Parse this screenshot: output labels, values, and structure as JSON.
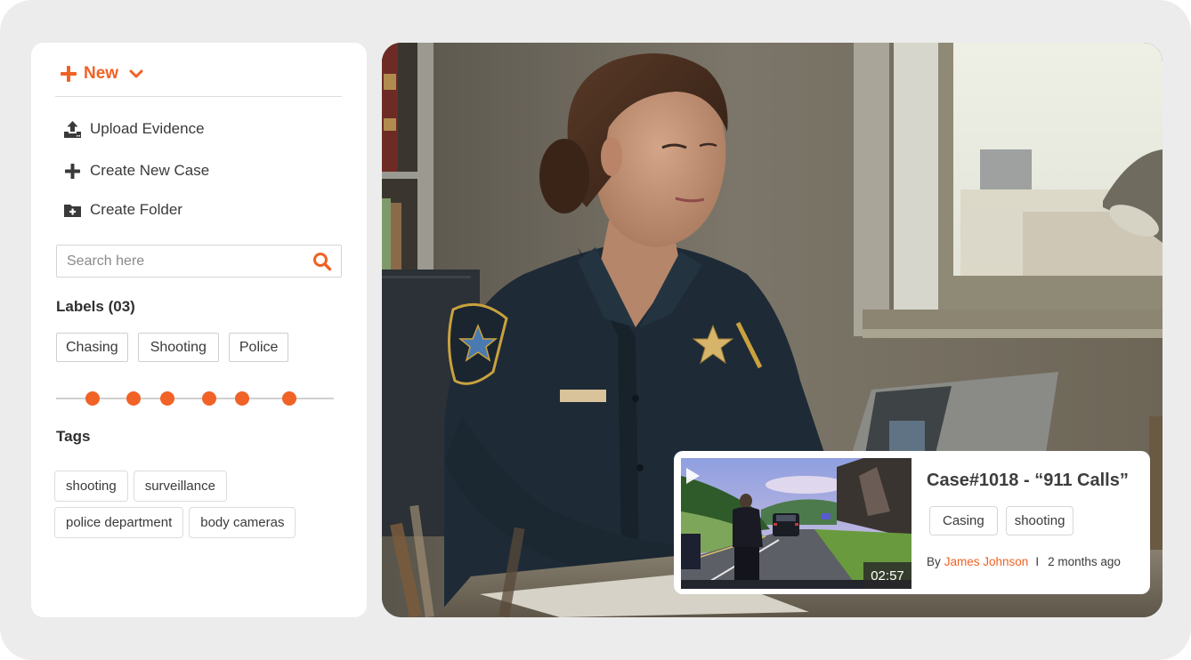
{
  "colors": {
    "accent": "#f06225",
    "frame_bg": "#ececec",
    "panel_bg": "#ffffff",
    "text": "#3a3a3a"
  },
  "sidebar": {
    "new_button": {
      "label": "New",
      "icons": [
        "plus-icon",
        "chevron-down-icon"
      ]
    },
    "menu": [
      {
        "label": "Upload Evidence",
        "icon": "upload-icon"
      },
      {
        "label": "Create New Case",
        "icon": "plus-icon"
      },
      {
        "label": "Create Folder",
        "icon": "folder-plus-icon"
      }
    ],
    "search": {
      "placeholder": "Search here",
      "value": "",
      "icon": "search-icon"
    },
    "labels": {
      "title": "Labels (03)",
      "items": [
        "Chasing",
        "Shooting",
        "Police"
      ]
    },
    "slider": {
      "handle_count": 6,
      "handle_positions_fraction": [
        0.13,
        0.28,
        0.4,
        0.55,
        0.67,
        0.84
      ]
    },
    "tags": {
      "title": "Tags",
      "items": [
        "shooting",
        "surveillance",
        "police department",
        "body cameras"
      ]
    }
  },
  "hero_image": {
    "description": "Female police officer in dark uniform working at a laptop in an office beside a window"
  },
  "case_card": {
    "title": "Case#1018 - “911 Calls”",
    "video": {
      "duration": "02:57",
      "icon": "play-icon",
      "description": "Dashcam footage of officer walking toward a stopped vehicle on a highway"
    },
    "tags": [
      "Casing",
      "shooting"
    ],
    "meta": {
      "by_label": "By",
      "author": "James Johnson",
      "separator": "I",
      "time_ago": "2 months ago"
    }
  }
}
